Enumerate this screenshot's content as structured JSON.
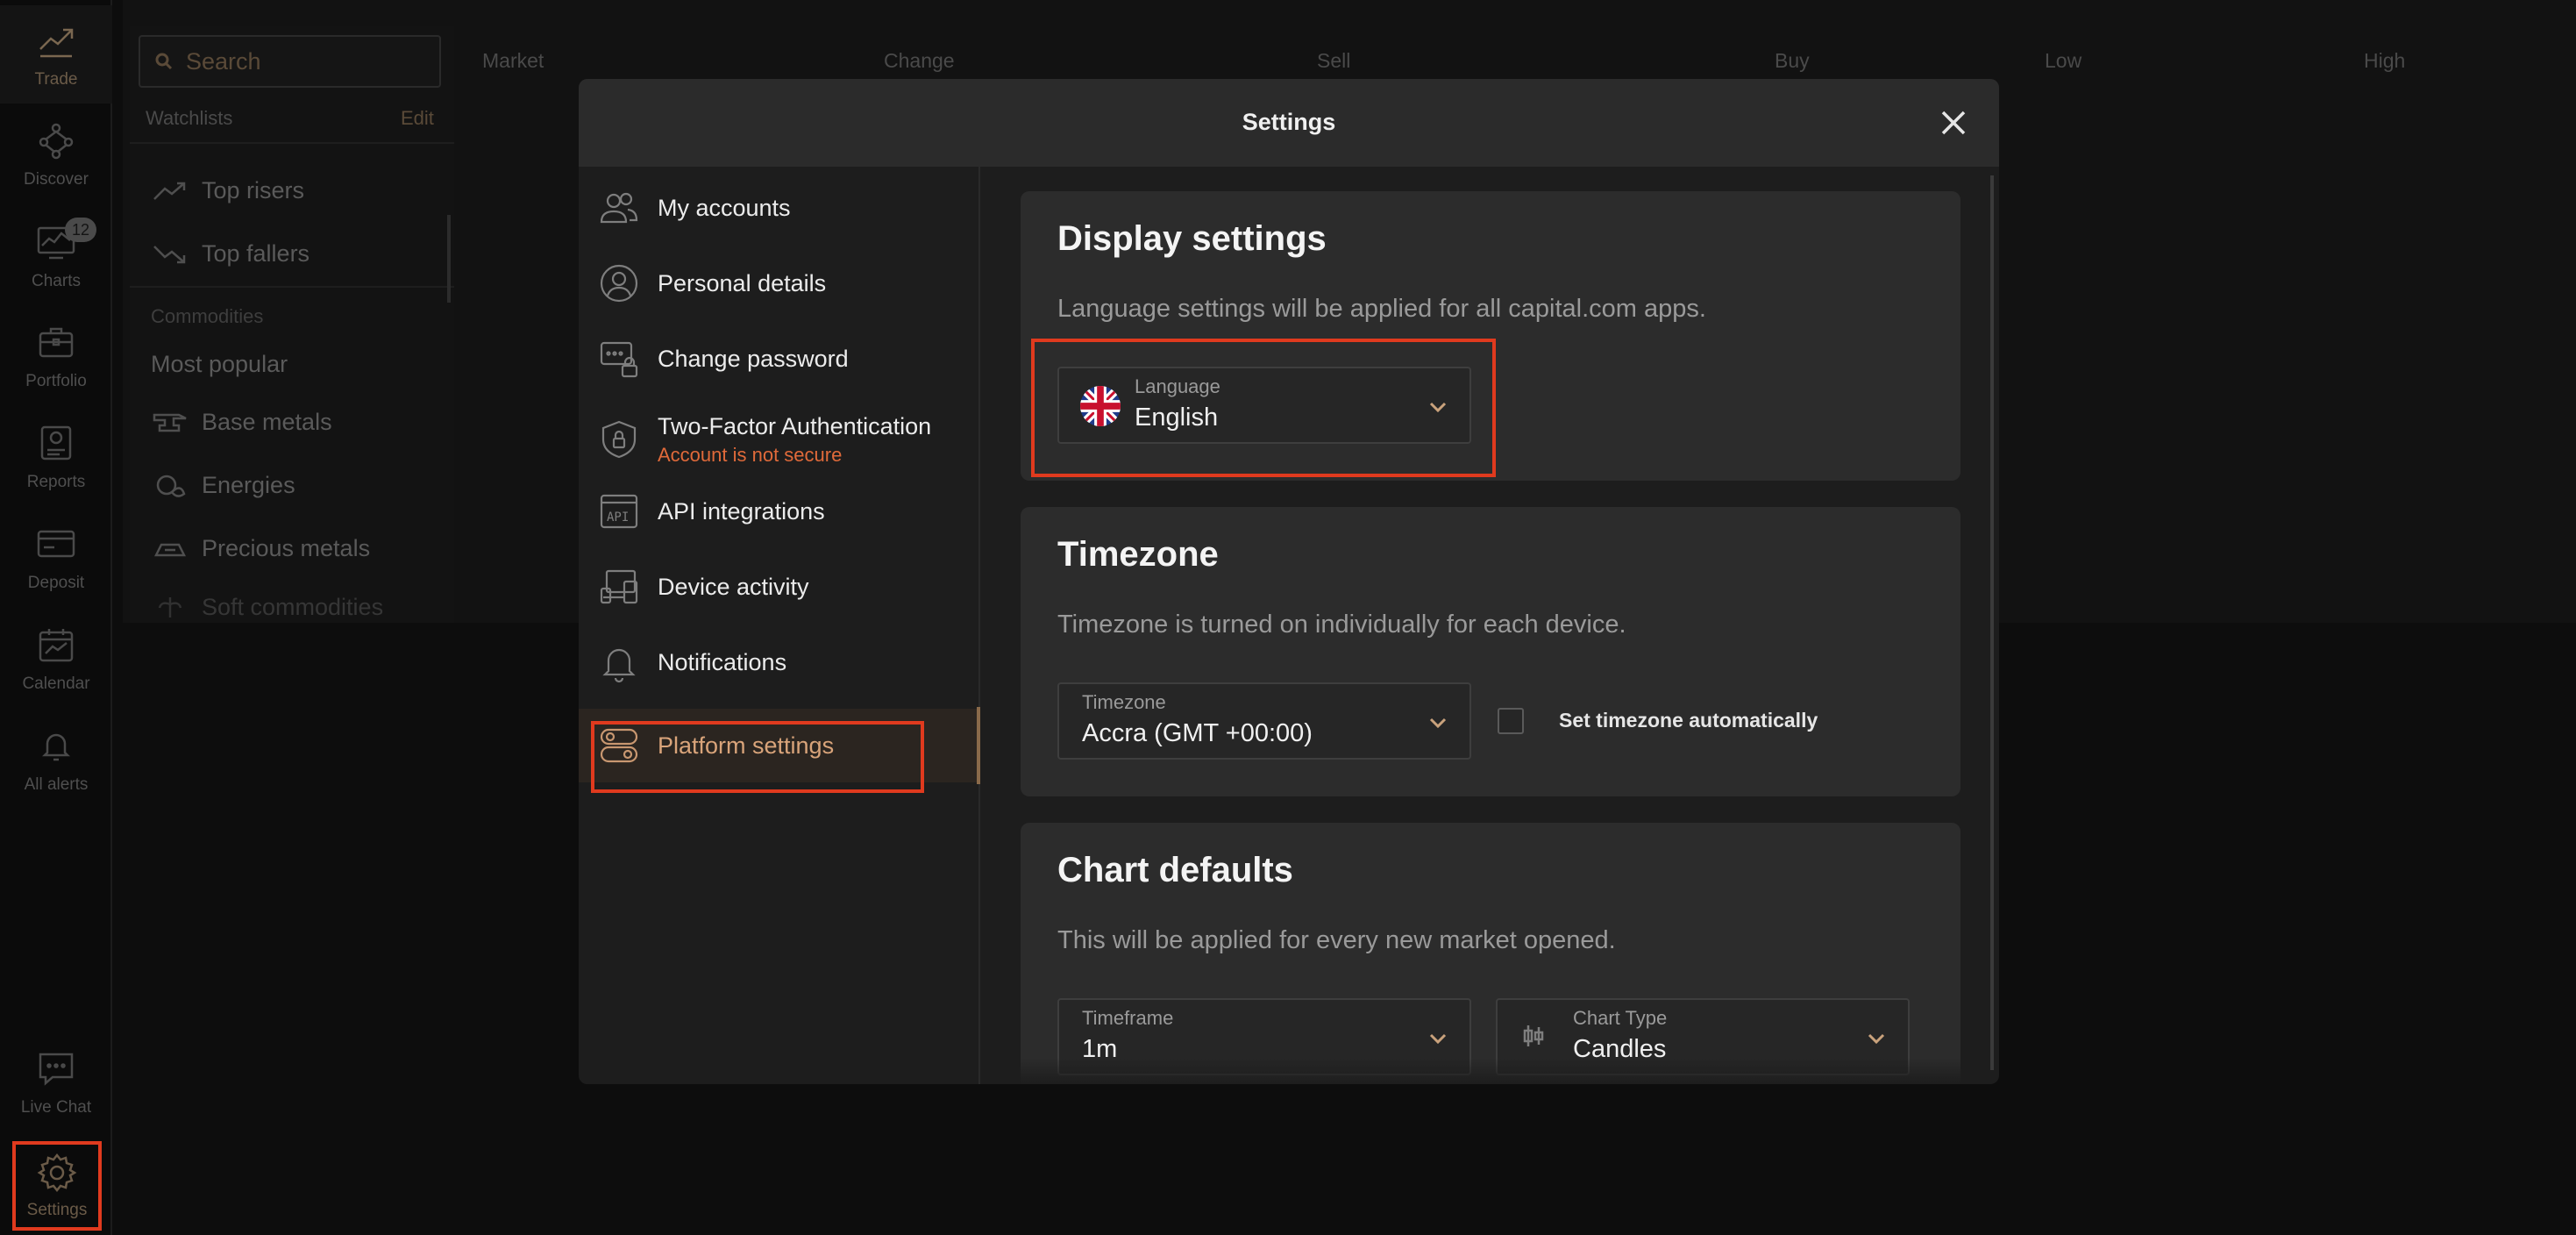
{
  "rail": {
    "items": [
      {
        "label": "Trade",
        "icon": "trade-icon"
      },
      {
        "label": "Discover",
        "icon": "discover-icon"
      },
      {
        "label": "Charts",
        "icon": "charts-icon",
        "badge": "12"
      },
      {
        "label": "Portfolio",
        "icon": "portfolio-icon"
      },
      {
        "label": "Reports",
        "icon": "reports-icon"
      },
      {
        "label": "Deposit",
        "icon": "deposit-icon"
      },
      {
        "label": "Calendar",
        "icon": "calendar-icon"
      },
      {
        "label": "All alerts",
        "icon": "bell-icon"
      },
      {
        "label": "Live Chat",
        "icon": "chat-icon"
      },
      {
        "label": "Settings",
        "icon": "gear-icon"
      }
    ]
  },
  "search": {
    "placeholder": "Search"
  },
  "market_columns": [
    "Market",
    "Change",
    "Sell",
    "Buy",
    "Low",
    "High"
  ],
  "watchlists": {
    "title": "Watchlists",
    "edit": "Edit",
    "items": [
      "Top risers",
      "Top fallers"
    ],
    "section": "Commodities",
    "section_items": [
      "Most popular",
      "Base metals",
      "Energies",
      "Precious metals",
      "Soft commodities"
    ]
  },
  "modal": {
    "title": "Settings",
    "nav": [
      {
        "label": "My accounts"
      },
      {
        "label": "Personal details"
      },
      {
        "label": "Change password"
      },
      {
        "label": "Two-Factor Authentication",
        "sub": "Account is not secure"
      },
      {
        "label": "API integrations"
      },
      {
        "label": "Device activity"
      },
      {
        "label": "Notifications"
      },
      {
        "label": "Platform settings"
      }
    ],
    "display": {
      "title": "Display settings",
      "desc": "Language settings will be applied for all capital.com apps.",
      "language_label": "Language",
      "language_value": "English"
    },
    "timezone": {
      "title": "Timezone",
      "desc": "Timezone is turned on individually for each device.",
      "tz_label": "Timezone",
      "tz_value": "Accra (GMT +00:00)",
      "auto_label": "Set timezone automatically"
    },
    "chart": {
      "title": "Chart defaults",
      "desc": "This will be applied for every new market opened.",
      "timeframe_label": "Timeframe",
      "timeframe_value": "1m",
      "type_label": "Chart Type",
      "type_value": "Candles"
    }
  },
  "colors": {
    "accent": "#d9a47a",
    "highlight": "#e03a1e",
    "warning": "#e06a3a"
  }
}
